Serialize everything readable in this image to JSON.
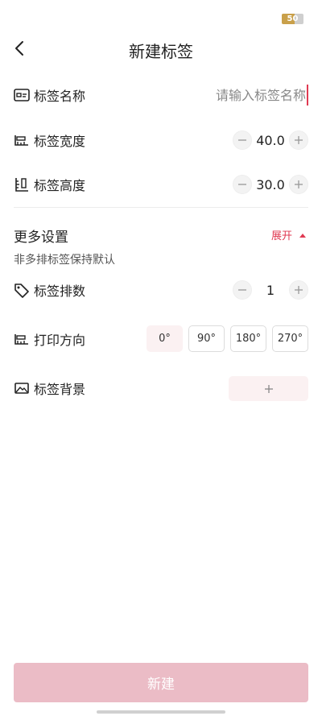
{
  "status_bar": {
    "battery": "50"
  },
  "header": {
    "title": "新建标签"
  },
  "fields": {
    "name": {
      "label": "标签名称",
      "placeholder": "请输入标签名称",
      "value": ""
    },
    "width": {
      "label": "标签宽度",
      "value": "40.0"
    },
    "height": {
      "label": "标签高度",
      "value": "30.0"
    }
  },
  "more_settings": {
    "title": "更多设置",
    "toggle_label": "展开",
    "hint": "非多排标签保持默认",
    "columns": {
      "label": "标签排数",
      "value": "1"
    },
    "direction": {
      "label": "打印方向",
      "options": [
        "0°",
        "90°",
        "180°",
        "270°"
      ],
      "selected": "0°"
    },
    "background": {
      "label": "标签背景"
    }
  },
  "footer": {
    "create_label": "新建"
  },
  "colors": {
    "accent": "#e03a52",
    "button_disabled": "#ebbcc6",
    "chip_active": "#fbf1f2"
  }
}
